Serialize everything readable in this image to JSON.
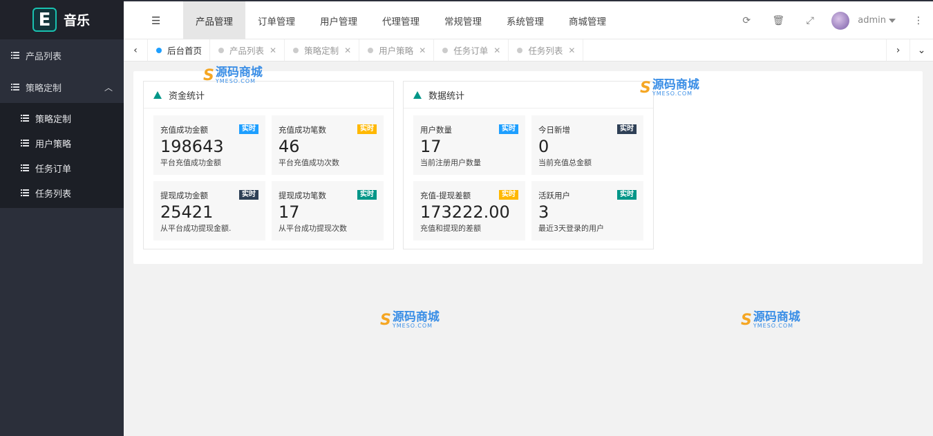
{
  "app": {
    "logo_letter": "E",
    "name": "音乐"
  },
  "sidebar": {
    "items": [
      {
        "label": "产品列表"
      },
      {
        "label": "策略定制",
        "expanded": true
      }
    ],
    "subitems": [
      {
        "label": "策略定制"
      },
      {
        "label": "用户策略"
      },
      {
        "label": "任务订单"
      },
      {
        "label": "任务列表"
      }
    ]
  },
  "topnav": [
    {
      "label": "产品管理",
      "active": true
    },
    {
      "label": "订单管理"
    },
    {
      "label": "用户管理"
    },
    {
      "label": "代理管理"
    },
    {
      "label": "常规管理"
    },
    {
      "label": "系统管理"
    },
    {
      "label": "商城管理"
    }
  ],
  "header": {
    "user": "admin"
  },
  "tabs": [
    {
      "label": "后台首页",
      "active": true
    },
    {
      "label": "产品列表"
    },
    {
      "label": "策略定制"
    },
    {
      "label": "用户策略"
    },
    {
      "label": "任务订单"
    },
    {
      "label": "任务列表"
    }
  ],
  "panels": [
    {
      "title": "资金统计",
      "stats": [
        {
          "title": "充值成功金额",
          "value": "198643",
          "desc": "平台充值成功金额",
          "badge": "实时",
          "badge_color": "#1e9fff"
        },
        {
          "title": "充值成功笔数",
          "value": "46",
          "desc": "平台充值成功次数",
          "badge": "实时",
          "badge_color": "#ffb800"
        },
        {
          "title": "提现成功金额",
          "value": "25421",
          "desc": "从平台成功提现金额.",
          "badge": "实时",
          "badge_color": "#2f4056"
        },
        {
          "title": "提现成功笔数",
          "value": "17",
          "desc": "从平台成功提现次数",
          "badge": "实时",
          "badge_color": "#009688"
        }
      ]
    },
    {
      "title": "数据统计",
      "stats": [
        {
          "title": "用户数量",
          "value": "17",
          "desc": "当前注册用户数量",
          "badge": "实时",
          "badge_color": "#1e9fff"
        },
        {
          "title": "今日新增",
          "value": "0",
          "desc": "当前充值总金额",
          "badge": "实时",
          "badge_color": "#2f4056"
        },
        {
          "title": "充值-提现差额",
          "value": "173222.00",
          "desc": "充值和提现的差额",
          "badge": "实时",
          "badge_color": "#ffb800"
        },
        {
          "title": "活跃用户",
          "value": "3",
          "desc": "最近3天登录的用户",
          "badge": "实时",
          "badge_color": "#009688"
        }
      ]
    }
  ],
  "watermark": {
    "cn": "源码商城",
    "en": "YMESO.COM"
  }
}
